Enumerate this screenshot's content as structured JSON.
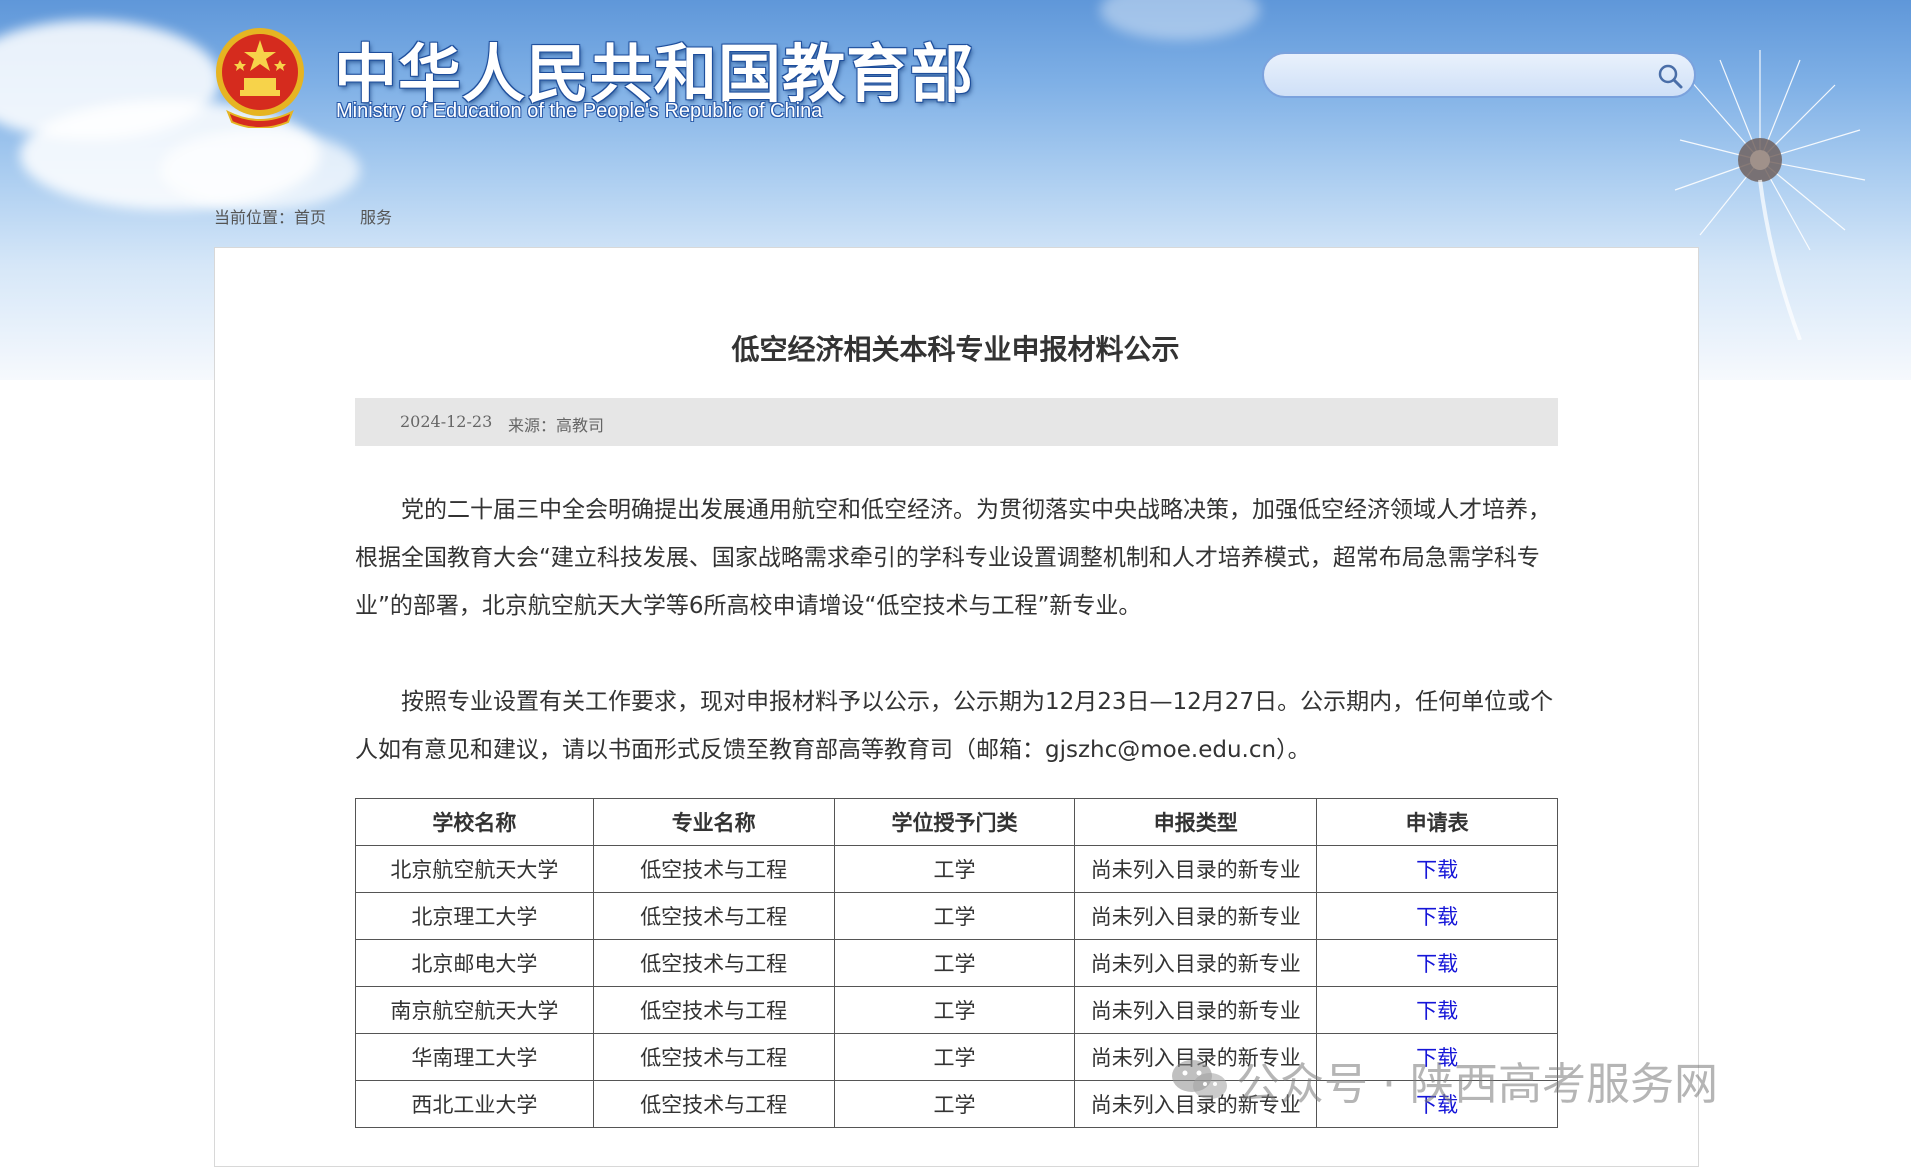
{
  "header": {
    "title_cn": "中华人民共和国教育部",
    "title_en": "Ministry of Education of the People's Republic of China",
    "search_placeholder": ""
  },
  "breadcrumb": {
    "prefix": "当前位置：",
    "items": [
      "首页",
      "服务"
    ]
  },
  "article": {
    "title": "低空经济相关本科专业申报材料公示",
    "date": "2024-12-23",
    "source": "来源：高教司",
    "paragraphs": [
      "党的二十届三中全会明确提出发展通用航空和低空经济。为贯彻落实中央战略决策，加强低空经济领域人才培养，根据全国教育大会“建立科技发展、国家战略需求牵引的学科专业设置调整机制和人才培养模式，超常布局急需学科专业”的部署，北京航空航天大学等6所高校申请增设“低空技术与工程”新专业。",
      "按照专业设置有关工作要求，现对申报材料予以公示，公示期为12月23日—12月27日。公示期内，任何单位或个人如有意见和建议，请以书面形式反馈至教育部高等教育司（邮箱：gjszhc@moe.edu.cn）。"
    ]
  },
  "table": {
    "headers": [
      "学校名称",
      "专业名称",
      "学位授予门类",
      "申报类型",
      "申请表"
    ],
    "rows": [
      [
        "北京航空航天大学",
        "低空技术与工程",
        "工学",
        "尚未列入目录的新专业",
        "下载"
      ],
      [
        "北京理工大学",
        "低空技术与工程",
        "工学",
        "尚未列入目录的新专业",
        "下载"
      ],
      [
        "北京邮电大学",
        "低空技术与工程",
        "工学",
        "尚未列入目录的新专业",
        "下载"
      ],
      [
        "南京航空航天大学",
        "低空技术与工程",
        "工学",
        "尚未列入目录的新专业",
        "下载"
      ],
      [
        "华南理工大学",
        "低空技术与工程",
        "工学",
        "尚未列入目录的新专业",
        "下载"
      ],
      [
        "西北工业大学",
        "低空技术与工程",
        "工学",
        "尚未列入目录的新专业",
        "下载"
      ]
    ]
  },
  "watermark": {
    "text": "公众号 · 陕西高考服务网",
    "icon": "wechat-icon"
  },
  "icons": {
    "emblem": "national-emblem-icon",
    "search": "search-icon"
  },
  "colors": {
    "link": "#1616d8",
    "meta_bar": "#e6e6e6",
    "sky": "#7fb0e6"
  }
}
